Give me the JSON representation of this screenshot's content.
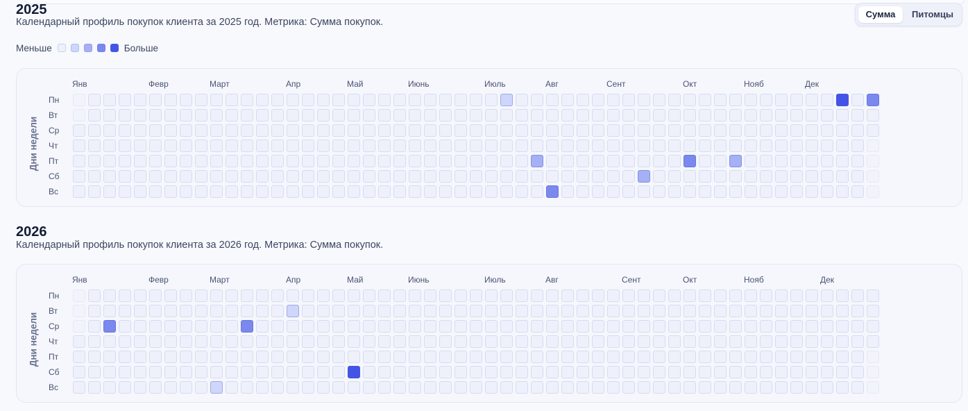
{
  "metric_toggle": {
    "options": [
      "Сумма",
      "Питомцы"
    ],
    "active": 0
  },
  "legend": {
    "less": "Меньше",
    "more": "Больше",
    "colors": [
      "#eef1fb",
      "#cfd6fb",
      "#a5b0f5",
      "#7b88ee",
      "#4454e6"
    ]
  },
  "y_axis_label": "Дни недели",
  "day_labels": [
    "Пн",
    "Вт",
    "Ср",
    "Чт",
    "Пт",
    "Сб",
    "Вс"
  ],
  "years": [
    {
      "year": "2025",
      "subtitle": "Календарный профиль покупок клиента за 2025 год. Метрика: Сумма покупок.",
      "months": [
        {
          "label": "Янв",
          "week": 0
        },
        {
          "label": "Февр",
          "week": 5
        },
        {
          "label": "Март",
          "week": 9
        },
        {
          "label": "Апр",
          "week": 14
        },
        {
          "label": "Май",
          "week": 18
        },
        {
          "label": "Июнь",
          "week": 22
        },
        {
          "label": "Июль",
          "week": 27
        },
        {
          "label": "Авг",
          "week": 31
        },
        {
          "label": "Сент",
          "week": 35
        },
        {
          "label": "Окт",
          "week": 40
        },
        {
          "label": "Нояб",
          "week": 44
        },
        {
          "label": "Дек",
          "week": 48
        }
      ],
      "out_of_range": [
        [
          0,
          0
        ],
        [
          0,
          1
        ],
        [
          52,
          3
        ],
        [
          52,
          4
        ],
        [
          52,
          5
        ],
        [
          52,
          6
        ]
      ],
      "highlights": [
        {
          "week": 28,
          "day": 0,
          "level": 1
        },
        {
          "week": 30,
          "day": 4,
          "level": 2
        },
        {
          "week": 31,
          "day": 6,
          "level": 3
        },
        {
          "week": 37,
          "day": 5,
          "level": 2
        },
        {
          "week": 40,
          "day": 4,
          "level": 3
        },
        {
          "week": 43,
          "day": 4,
          "level": 2
        },
        {
          "week": 50,
          "day": 0,
          "level": 4
        },
        {
          "week": 52,
          "day": 0,
          "level": 3
        }
      ]
    },
    {
      "year": "2026",
      "subtitle": "Календарный профиль покупок клиента за 2026 год. Метрика: Сумма покупок.",
      "months": [
        {
          "label": "Янв",
          "week": 0
        },
        {
          "label": "Февр",
          "week": 5
        },
        {
          "label": "Март",
          "week": 9
        },
        {
          "label": "Апр",
          "week": 14
        },
        {
          "label": "Май",
          "week": 18
        },
        {
          "label": "Июнь",
          "week": 22
        },
        {
          "label": "Июль",
          "week": 27
        },
        {
          "label": "Авг",
          "week": 31
        },
        {
          "label": "Сент",
          "week": 36
        },
        {
          "label": "Окт",
          "week": 40
        },
        {
          "label": "Нояб",
          "week": 44
        },
        {
          "label": "Дек",
          "week": 49
        }
      ],
      "out_of_range": [
        [
          0,
          0
        ],
        [
          0,
          1
        ],
        [
          0,
          2
        ],
        [
          52,
          4
        ],
        [
          52,
          5
        ],
        [
          52,
          6
        ]
      ],
      "highlights": [
        {
          "week": 2,
          "day": 2,
          "level": 3
        },
        {
          "week": 9,
          "day": 6,
          "level": 1
        },
        {
          "week": 11,
          "day": 2,
          "level": 3
        },
        {
          "week": 14,
          "day": 1,
          "level": 1
        },
        {
          "week": 18,
          "day": 5,
          "level": 4
        }
      ]
    }
  ]
}
